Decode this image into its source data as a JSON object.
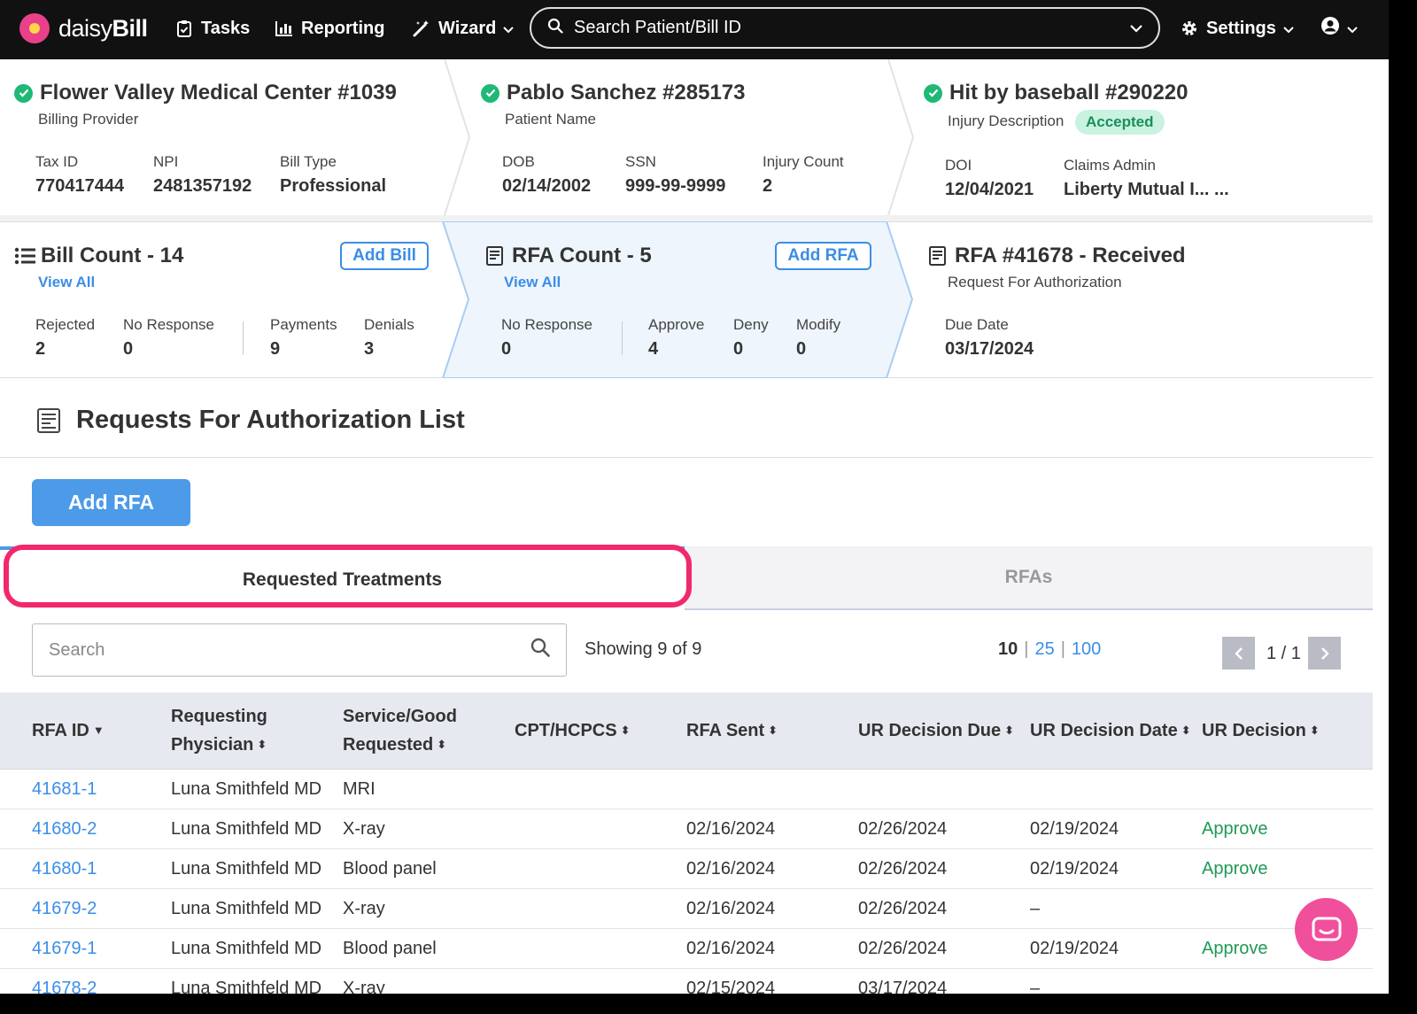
{
  "topbar": {
    "logo_text_a": "daisy",
    "logo_text_b": "Bill",
    "tasks": "Tasks",
    "reporting": "Reporting",
    "wizard": "Wizard",
    "search_placeholder": "Search Patient/Bill ID",
    "settings": "Settings"
  },
  "provider": {
    "title": "Flower Valley Medical Center #1039",
    "subtitle": "Billing Provider",
    "tax_id_label": "Tax ID",
    "tax_id": "770417444",
    "npi_label": "NPI",
    "npi": "2481357192",
    "bill_type_label": "Bill Type",
    "bill_type": "Professional"
  },
  "patient": {
    "title": "Pablo Sanchez #285173",
    "subtitle": "Patient Name",
    "dob_label": "DOB",
    "dob": "02/14/2002",
    "ssn_label": "SSN",
    "ssn": "999-99-9999",
    "injury_count_label": "Injury Count",
    "injury_count": "2"
  },
  "injury": {
    "title": "Hit by baseball #290220",
    "subtitle": "Injury Description",
    "status": "Accepted",
    "doi_label": "DOI",
    "doi": "12/04/2021",
    "claims_admin_label": "Claims Admin",
    "claims_admin": "Liberty Mutual I... ..."
  },
  "bills": {
    "title": "Bill Count - 14",
    "view_all": "View All",
    "add_button": "Add Bill",
    "rejected_label": "Rejected",
    "rejected": "2",
    "no_response_label": "No Response",
    "no_response": "0",
    "payments_label": "Payments",
    "payments": "9",
    "denials_label": "Denials",
    "denials": "3"
  },
  "rfas": {
    "title": "RFA Count - 5",
    "view_all": "View All",
    "add_button": "Add RFA",
    "no_response_label": "No Response",
    "no_response": "0",
    "approve_label": "Approve",
    "approve": "4",
    "deny_label": "Deny",
    "deny": "0",
    "modify_label": "Modify",
    "modify": "0"
  },
  "rfa_current": {
    "title": "RFA #41678 - Received",
    "subtitle": "Request For Authorization",
    "due_date_label": "Due Date",
    "due_date": "03/17/2024"
  },
  "section": {
    "title": "Requests For Authorization List",
    "add_button": "Add RFA"
  },
  "tabs": {
    "requested_treatments": "Requested Treatments",
    "rfas": "RFAs"
  },
  "table_toolbar": {
    "search_placeholder": "Search",
    "showing": "Showing 9 of 9",
    "page_size_10": "10",
    "page_size_25": "25",
    "page_size_100": "100",
    "page_indicator": "1 / 1"
  },
  "table": {
    "headers": {
      "rfa_id": "RFA ID",
      "physician_1": "Requesting",
      "physician_2": "Physician",
      "service_1": "Service/Good",
      "service_2": "Requested",
      "cpt": "CPT/HCPCS",
      "rfa_sent": "RFA Sent",
      "ur_due": "UR Decision Due",
      "ur_date": "UR Decision Date",
      "ur_decision": "UR Decision"
    },
    "rows": [
      {
        "id": "41681-1",
        "physician": "Luna Smithfeld MD",
        "service": "MRI",
        "cpt": "",
        "sent": "",
        "due": "",
        "date": "",
        "decision": ""
      },
      {
        "id": "41680-2",
        "physician": "Luna Smithfeld MD",
        "service": "X-ray",
        "cpt": "",
        "sent": "02/16/2024",
        "due": "02/26/2024",
        "date": "02/19/2024",
        "decision": "Approve"
      },
      {
        "id": "41680-1",
        "physician": "Luna Smithfeld MD",
        "service": "Blood panel",
        "cpt": "",
        "sent": "02/16/2024",
        "due": "02/26/2024",
        "date": "02/19/2024",
        "decision": "Approve"
      },
      {
        "id": "41679-2",
        "physician": "Luna Smithfeld MD",
        "service": "X-ray",
        "cpt": "",
        "sent": "02/16/2024",
        "due": "02/26/2024",
        "date": "–",
        "decision": ""
      },
      {
        "id": "41679-1",
        "physician": "Luna Smithfeld MD",
        "service": "Blood panel",
        "cpt": "",
        "sent": "02/16/2024",
        "due": "02/26/2024",
        "date": "02/19/2024",
        "decision": "Approve"
      },
      {
        "id": "41678-2",
        "physician": "Luna Smithfeld MD",
        "service": "X-ray",
        "cpt": "",
        "sent": "02/15/2024",
        "due": "03/17/2024",
        "date": "–",
        "decision": ""
      }
    ]
  },
  "colors": {
    "accent": "#4d9ae8",
    "link": "#3a8ee6",
    "success": "#1fb877",
    "highlight": "#f2286e",
    "chat": "#f04f9b"
  }
}
